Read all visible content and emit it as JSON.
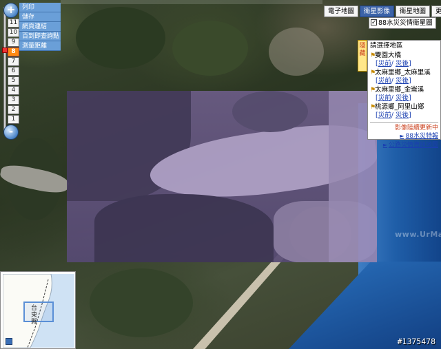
{
  "zoom": {
    "plus_label": "+",
    "minus_label": "-",
    "levels": [
      "11",
      "10",
      "9",
      "8",
      "7",
      "6",
      "5",
      "4",
      "3",
      "2",
      "1"
    ],
    "current_level": "8"
  },
  "tools": {
    "items": [
      "列印",
      "儲存",
      "網頁連結",
      "百到即查詢點",
      "測量距離"
    ]
  },
  "map_types": {
    "buttons": [
      "電子地圖",
      "衛星影像",
      "衛星地圖",
      "更多"
    ],
    "active": "衛星影像"
  },
  "layer": {
    "label": "88水災災情衛星圖",
    "checked": true
  },
  "area_panel": {
    "tab_label": "隱藏",
    "title": "請選擇地區",
    "locations": [
      {
        "name": "雙園大橋",
        "links": [
          "災前",
          "災後"
        ]
      },
      {
        "name": "太麻里鄉_太麻里溪",
        "links": [
          "災前",
          "災後"
        ]
      },
      {
        "name": "太麻里鄉_金崙溪",
        "links": [
          "災前",
          "災後"
        ]
      },
      {
        "name": "桃源鄉_阿里山鄉",
        "links": [
          "災前",
          "災後"
        ]
      }
    ],
    "updating_text": "影像陸續更新中",
    "extra_links": [
      "88水災特報",
      "公路災情資訊地圖"
    ]
  },
  "overview": {
    "label": "台東縣"
  },
  "watermark": "www.UrMap.com",
  "post_id": "#1375478",
  "colors": {
    "button_blue": "#3c63a8",
    "tool_blue": "#6a9fd8",
    "active_level": "#ff8a14",
    "flood_overlay": "#6b5c86",
    "ocean": "#1f5ea8"
  }
}
